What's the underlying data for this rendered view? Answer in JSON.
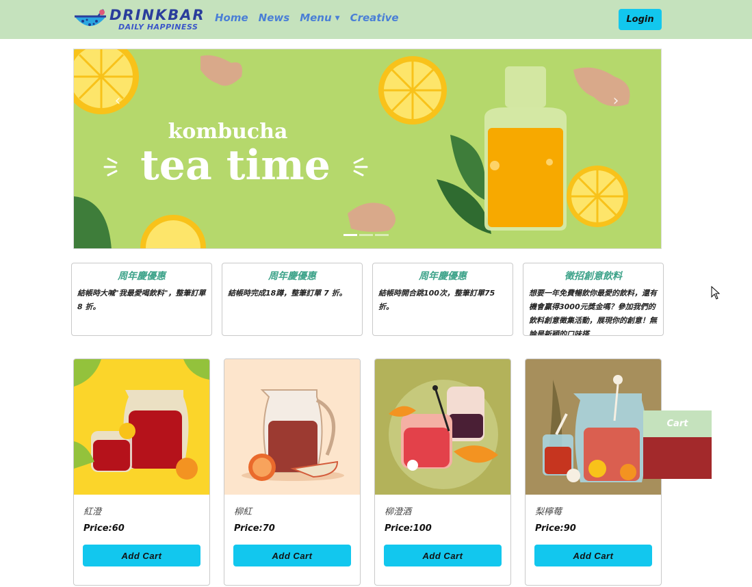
{
  "brand": {
    "name": "DRINKBAR",
    "tagline": "DAILY HAPPINESS"
  },
  "nav": {
    "links": [
      "Home",
      "News",
      "Menu",
      "Creative"
    ],
    "login_label": "Login"
  },
  "carousel": {
    "headline_small": "kombucha",
    "headline_big": "tea time",
    "prev_icon": "chevron-left-icon",
    "next_icon": "chevron-right-icon",
    "indicator_count": 3,
    "active_indicator": 0
  },
  "promos": [
    {
      "title": "周年慶優惠",
      "body": "結帳時大喊\"我最愛喝飲料\"，整筆訂單 8 折。"
    },
    {
      "title": "周年慶優惠",
      "body": "結帳時完成18蹲，整筆訂單 7 折。"
    },
    {
      "title": "周年慶優惠",
      "body": "結帳時開合跳100次，整筆訂單75 折。"
    },
    {
      "title": "徵招創意飲料",
      "body": "想要一年免費暢飲你最愛的飲料，還有機會贏得3000元獎金嗎？參加我們的飲料創意徵集活動，展現你的創意！無論是新穎的口味搭"
    }
  ],
  "products": [
    {
      "name": "紅澄",
      "price": "Price:60",
      "button": "Add Cart"
    },
    {
      "name": "柳紅",
      "price": "Price:70",
      "button": "Add Cart"
    },
    {
      "name": "柳澄酒",
      "price": "Price:100",
      "button": "Add Cart"
    },
    {
      "name": "梨檸莓",
      "price": "Price:90",
      "button": "Add Cart"
    }
  ],
  "cart": {
    "label": "Cart"
  },
  "colors": {
    "navbar": "#c5e2bd",
    "accent_button": "#12c7ee",
    "promo_title": "#3ea38a",
    "cart_body": "#a3292b"
  }
}
